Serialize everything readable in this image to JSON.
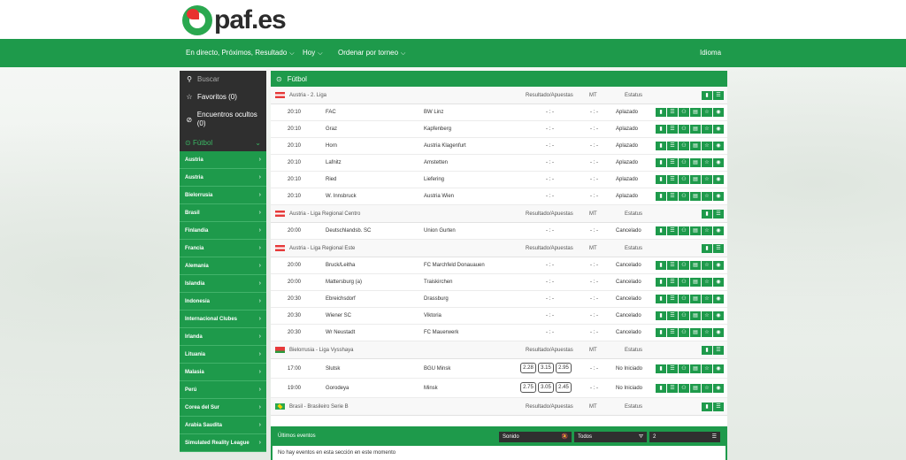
{
  "logo": {
    "text": "paf.es"
  },
  "nav": {
    "items": [
      {
        "label": "En directo, Próximos, Resultado"
      },
      {
        "label": "Hoy"
      },
      {
        "label": "Ordenar por torneo"
      }
    ],
    "language": "Idioma"
  },
  "sidebar": {
    "search": "Buscar",
    "favorites": "Favoritos (0)",
    "hidden": "Encuentros ocultos (0)",
    "sport": "Fútbol",
    "countries": [
      "Austria",
      "Austria",
      "Bielorrusia",
      "Brasil",
      "Finlandia",
      "Francia",
      "Alemania",
      "Islandia",
      "Indonesia",
      "Internacional Clubes",
      "Irlanda",
      "Lituania",
      "Malasia",
      "Perú",
      "Corea del Sur",
      "Arabia Saudita",
      "Simulated Reality League"
    ]
  },
  "main": {
    "title": "Fútbol",
    "col_result": "Resultado/Apuestas",
    "col_mt": "MT",
    "col_status": "Estatus",
    "leagues": [
      {
        "name": "Austria - 2. Liga",
        "flag": "at",
        "matches": [
          {
            "time": "20:10",
            "home": "FAC",
            "away": "BW Linz",
            "result": "- : -",
            "mt": "- : -",
            "status": "Aplazado"
          },
          {
            "time": "20:10",
            "home": "Graz",
            "away": "Kapfenberg",
            "result": "- : -",
            "mt": "- : -",
            "status": "Aplazado"
          },
          {
            "time": "20:10",
            "home": "Horn",
            "away": "Austria Klagenfurt",
            "result": "- : -",
            "mt": "- : -",
            "status": "Aplazado"
          },
          {
            "time": "20:10",
            "home": "Lafnitz",
            "away": "Amstetten",
            "result": "- : -",
            "mt": "- : -",
            "status": "Aplazado"
          },
          {
            "time": "20:10",
            "home": "Ried",
            "away": "Liefering",
            "result": "- : -",
            "mt": "- : -",
            "status": "Aplazado"
          },
          {
            "time": "20:10",
            "home": "W. Innsbruck",
            "away": "Austria Wien",
            "result": "- : -",
            "mt": "- : -",
            "status": "Aplazado"
          }
        ]
      },
      {
        "name": "Austria - Liga Regional Centro",
        "flag": "at",
        "matches": [
          {
            "time": "20:00",
            "home": "Deutschlandsb. SC",
            "away": "Union Gurten",
            "result": "- : -",
            "mt": "- : -",
            "status": "Cancelado"
          }
        ]
      },
      {
        "name": "Austria - Liga Regional Este",
        "flag": "at",
        "matches": [
          {
            "time": "20:00",
            "home": "Bruck/Leitha",
            "away": "FC Marchfeld Donauauen",
            "result": "- : -",
            "mt": "- : -",
            "status": "Cancelado"
          },
          {
            "time": "20:00",
            "home": "Mattersburg (a)",
            "away": "Traiskirchen",
            "result": "- : -",
            "mt": "- : -",
            "status": "Cancelado"
          },
          {
            "time": "20:30",
            "home": "Ebreichsdorf",
            "away": "Drassburg",
            "result": "- : -",
            "mt": "- : -",
            "status": "Cancelado"
          },
          {
            "time": "20:30",
            "home": "Wiener SC",
            "away": "Viktoria",
            "result": "- : -",
            "mt": "- : -",
            "status": "Cancelado"
          },
          {
            "time": "20:30",
            "home": "Wr Neustadt",
            "away": "FC Mauerwerk",
            "result": "- : -",
            "mt": "- : -",
            "status": "Cancelado"
          }
        ]
      },
      {
        "name": "Bielorrusia - Liga Vysshaya",
        "flag": "by",
        "matches": [
          {
            "time": "17:00",
            "home": "Slutsk",
            "away": "BGU Minsk",
            "odds": [
              "2.28",
              "3.15",
              "2.95"
            ],
            "mt": "- : -",
            "status": "No Iniciado"
          },
          {
            "time": "19:00",
            "home": "Gorodeya",
            "away": "Minsk",
            "odds": [
              "2.75",
              "3.05",
              "2.45"
            ],
            "mt": "- : -",
            "status": "No Iniciado"
          }
        ]
      },
      {
        "name": "Brasil - Brasileiro Serie B",
        "flag": "br",
        "matches": []
      }
    ]
  },
  "bottom": {
    "title": "Últimos eventos",
    "sound": "Sonido",
    "filter": "Todos",
    "count": "2",
    "message": "No hay eventos en esta sección en este momento"
  },
  "colors": {
    "green": "#1e9a4b",
    "dark": "#2f2f2f"
  }
}
